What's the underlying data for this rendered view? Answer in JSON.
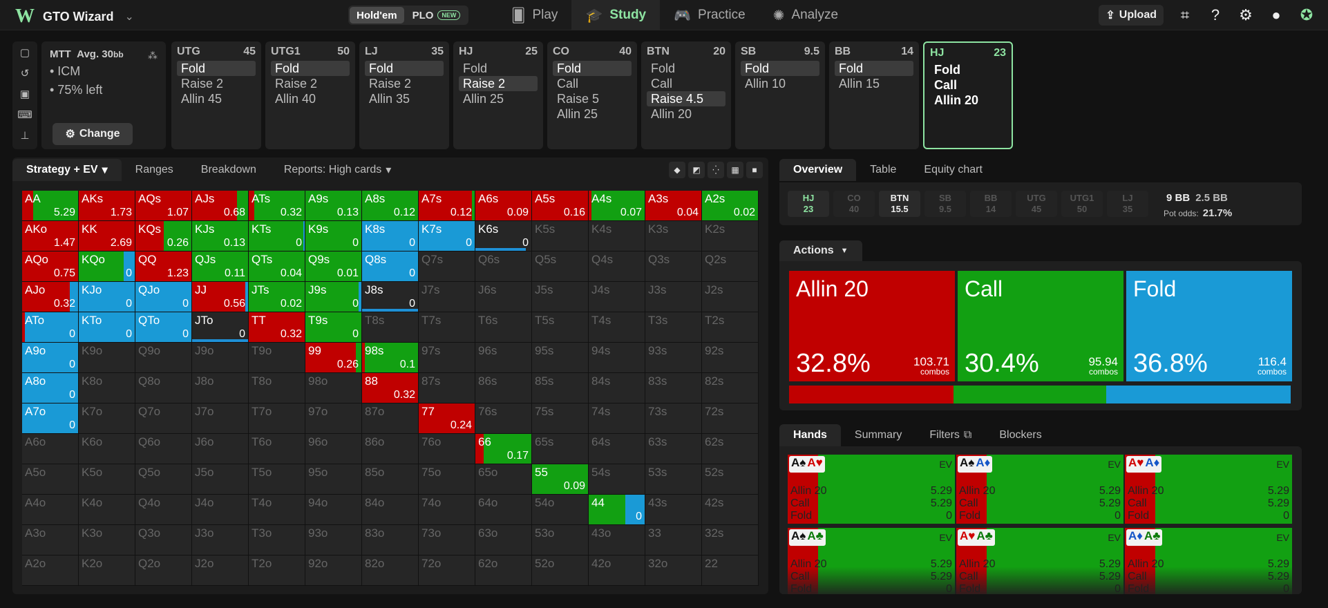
{
  "brand": {
    "logo": "W",
    "name": "GTO Wizard"
  },
  "game_toggle": {
    "holdem": "Hold'em",
    "plo": "PLO",
    "plo_badge": "NEW"
  },
  "nav": [
    {
      "label": "Play",
      "icon": "cards-icon",
      "active": false
    },
    {
      "label": "Study",
      "icon": "graduation-cap-icon",
      "active": true
    },
    {
      "label": "Practice",
      "icon": "gamepad-icon",
      "active": false
    },
    {
      "label": "Analyze",
      "icon": "lightbulb-icon",
      "active": false
    }
  ],
  "topright": {
    "upload": "Upload"
  },
  "mtt": {
    "title": "MTT",
    "depth": "Avg. 30",
    "depth_unit": "bb",
    "line1": "• ICM",
    "line2": "• 75% left",
    "change": "Change"
  },
  "positions": [
    {
      "name": "UTG",
      "stack": "45",
      "actions": [
        "Fold",
        "Raise 2",
        "Allin 45"
      ],
      "selected": 0
    },
    {
      "name": "UTG1",
      "stack": "50",
      "actions": [
        "Fold",
        "Raise 2",
        "Allin 40"
      ],
      "selected": 0
    },
    {
      "name": "LJ",
      "stack": "35",
      "actions": [
        "Fold",
        "Raise 2",
        "Allin 35"
      ],
      "selected": 0
    },
    {
      "name": "HJ",
      "stack": "25",
      "actions": [
        "Fold",
        "Raise 2",
        "Allin 25"
      ],
      "selected": 1
    },
    {
      "name": "CO",
      "stack": "40",
      "actions": [
        "Fold",
        "Call",
        "Raise 5",
        "Allin 25"
      ],
      "selected": 0
    },
    {
      "name": "BTN",
      "stack": "20",
      "actions": [
        "Fold",
        "Call",
        "Raise 4.5",
        "Allin 20"
      ],
      "selected": 2
    },
    {
      "name": "SB",
      "stack": "9.5",
      "actions": [
        "Fold",
        "Allin 10"
      ],
      "selected": 0
    },
    {
      "name": "BB",
      "stack": "14",
      "actions": [
        "Fold",
        "Allin 15"
      ],
      "selected": 0
    },
    {
      "name": "HJ",
      "stack": "23",
      "actions": [
        "Fold",
        "Call",
        "Allin 20"
      ],
      "selected": -1,
      "active": true
    }
  ],
  "left_tabs": [
    {
      "label": "Strategy + EV",
      "dropdown": true,
      "active": true
    },
    {
      "label": "Ranges"
    },
    {
      "label": "Breakdown"
    },
    {
      "label": "Reports: High cards",
      "dropdown": true
    }
  ],
  "colors": {
    "allin": "#c00000",
    "call": "#12a012",
    "fold": "#1a9ad6",
    "accent": "#8ee4a2"
  },
  "grid": [
    [
      [
        "AA",
        "5.29",
        0.2,
        0.8
      ],
      [
        "AKs",
        "1.73",
        1,
        0
      ],
      [
        "AQs",
        "1.07",
        1,
        0
      ],
      [
        "AJs",
        "0.68",
        0.8,
        0.2
      ],
      [
        "ATs",
        "0.32",
        0.1,
        0.9
      ],
      [
        "A9s",
        "0.13",
        0,
        1
      ],
      [
        "A8s",
        "0.12",
        0,
        1
      ],
      [
        "A7s",
        "0.12",
        0.95,
        0.05
      ],
      [
        "A6s",
        "0.09",
        1,
        0
      ],
      [
        "A5s",
        "0.16",
        1,
        0
      ],
      [
        "A4s",
        "0.07",
        0.05,
        0.95
      ],
      [
        "A3s",
        "0.04",
        1,
        0
      ],
      [
        "A2s",
        "0.02",
        0,
        1
      ]
    ],
    [
      [
        "AKo",
        "1.47",
        1,
        0
      ],
      [
        "KK",
        "2.69",
        1,
        0
      ],
      [
        "KQs",
        "0.26",
        0.5,
        0.5
      ],
      [
        "KJs",
        "0.13",
        0,
        1
      ],
      [
        "KTs",
        "0",
        0,
        0.97
      ],
      [
        "K9s",
        "0",
        0,
        1
      ],
      [
        "K8s",
        "0",
        0,
        0
      ],
      [
        "K7s",
        "0",
        0,
        0
      ],
      [
        "K6s",
        "0",
        0,
        0,
        0.9
      ],
      [
        "K5s",
        null
      ],
      [
        "K4s",
        null
      ],
      [
        "K3s",
        null
      ],
      [
        "K2s",
        null
      ]
    ],
    [
      [
        "AQo",
        "0.75",
        1,
        0
      ],
      [
        "KQo",
        "0",
        0,
        0.8
      ],
      [
        "QQ",
        "1.23",
        1,
        0
      ],
      [
        "QJs",
        "0.11",
        0,
        1
      ],
      [
        "QTs",
        "0.04",
        0,
        1
      ],
      [
        "Q9s",
        "0.01",
        0,
        1
      ],
      [
        "Q8s",
        "0",
        0,
        0
      ],
      [
        "Q7s",
        null
      ],
      [
        "Q6s",
        null
      ],
      [
        "Q5s",
        null
      ],
      [
        "Q4s",
        null
      ],
      [
        "Q3s",
        null
      ],
      [
        "Q2s",
        null
      ]
    ],
    [
      [
        "AJo",
        "0.32",
        0.85,
        0
      ],
      [
        "KJo",
        "0",
        0,
        0
      ],
      [
        "QJo",
        "0",
        0,
        0
      ],
      [
        "JJ",
        "0.56",
        0.95,
        0
      ],
      [
        "JTs",
        "0.02",
        0,
        1
      ],
      [
        "J9s",
        "0",
        0,
        0.95
      ],
      [
        "J8s",
        "0",
        0,
        0,
        1
      ],
      [
        "J7s",
        null
      ],
      [
        "J6s",
        null
      ],
      [
        "J5s",
        null
      ],
      [
        "J4s",
        null
      ],
      [
        "J3s",
        null
      ],
      [
        "J2s",
        null
      ]
    ],
    [
      [
        "ATo",
        "0",
        0.05,
        0
      ],
      [
        "KTo",
        "0",
        0,
        0
      ],
      [
        "QTo",
        "0",
        0,
        0
      ],
      [
        "JTo",
        "0",
        0,
        0,
        1
      ],
      [
        "TT",
        "0.32",
        1,
        0
      ],
      [
        "T9s",
        "0",
        0,
        1
      ],
      [
        "T8s",
        null
      ],
      [
        "T7s",
        null
      ],
      [
        "T6s",
        null
      ],
      [
        "T5s",
        null
      ],
      [
        "T4s",
        null
      ],
      [
        "T3s",
        null
      ],
      [
        "T2s",
        null
      ]
    ],
    [
      [
        "A9o",
        "0",
        0,
        0
      ],
      [
        "K9o",
        null
      ],
      [
        "Q9o",
        null
      ],
      [
        "J9o",
        null
      ],
      [
        "T9o",
        null
      ],
      [
        "99",
        "0.26",
        0.9,
        0.1
      ],
      [
        "98s",
        "0.1",
        0.05,
        0.95
      ],
      [
        "97s",
        null
      ],
      [
        "96s",
        null
      ],
      [
        "95s",
        null
      ],
      [
        "94s",
        null
      ],
      [
        "93s",
        null
      ],
      [
        "92s",
        null
      ]
    ],
    [
      [
        "A8o",
        "0",
        0,
        0
      ],
      [
        "K8o",
        null
      ],
      [
        "Q8o",
        null
      ],
      [
        "J8o",
        null
      ],
      [
        "T8o",
        null
      ],
      [
        "98o",
        null
      ],
      [
        "88",
        "0.32",
        1,
        0
      ],
      [
        "87s",
        null
      ],
      [
        "86s",
        null
      ],
      [
        "85s",
        null
      ],
      [
        "84s",
        null
      ],
      [
        "83s",
        null
      ],
      [
        "82s",
        null
      ]
    ],
    [
      [
        "A7o",
        "0",
        0,
        0
      ],
      [
        "K7o",
        null
      ],
      [
        "Q7o",
        null
      ],
      [
        "J7o",
        null
      ],
      [
        "T7o",
        null
      ],
      [
        "97o",
        null
      ],
      [
        "87o",
        null
      ],
      [
        "77",
        "0.24",
        1,
        0
      ],
      [
        "76s",
        null
      ],
      [
        "75s",
        null
      ],
      [
        "74s",
        null
      ],
      [
        "73s",
        null
      ],
      [
        "72s",
        null
      ]
    ],
    [
      [
        "A6o",
        null
      ],
      [
        "K6o",
        null
      ],
      [
        "Q6o",
        null
      ],
      [
        "J6o",
        null
      ],
      [
        "T6o",
        null
      ],
      [
        "96o",
        null
      ],
      [
        "86o",
        null
      ],
      [
        "76o",
        null
      ],
      [
        "66",
        "0.17",
        0.15,
        0.85
      ],
      [
        "65s",
        null
      ],
      [
        "64s",
        null
      ],
      [
        "63s",
        null
      ],
      [
        "62s",
        null
      ]
    ],
    [
      [
        "A5o",
        null
      ],
      [
        "K5o",
        null
      ],
      [
        "Q5o",
        null
      ],
      [
        "J5o",
        null
      ],
      [
        "T5o",
        null
      ],
      [
        "95o",
        null
      ],
      [
        "85o",
        null
      ],
      [
        "75o",
        null
      ],
      [
        "65o",
        null
      ],
      [
        "55",
        "0.09",
        0,
        1
      ],
      [
        "54s",
        null
      ],
      [
        "53s",
        null
      ],
      [
        "52s",
        null
      ]
    ],
    [
      [
        "A4o",
        null
      ],
      [
        "K4o",
        null
      ],
      [
        "Q4o",
        null
      ],
      [
        "J4o",
        null
      ],
      [
        "T4o",
        null
      ],
      [
        "94o",
        null
      ],
      [
        "84o",
        null
      ],
      [
        "74o",
        null
      ],
      [
        "64o",
        null
      ],
      [
        "54o",
        null
      ],
      [
        "44",
        "0",
        0,
        0.65
      ],
      [
        "43s",
        null
      ],
      [
        "42s",
        null
      ]
    ],
    [
      [
        "A3o",
        null
      ],
      [
        "K3o",
        null
      ],
      [
        "Q3o",
        null
      ],
      [
        "J3o",
        null
      ],
      [
        "T3o",
        null
      ],
      [
        "93o",
        null
      ],
      [
        "83o",
        null
      ],
      [
        "73o",
        null
      ],
      [
        "63o",
        null
      ],
      [
        "53o",
        null
      ],
      [
        "43o",
        null
      ],
      [
        "33",
        null
      ],
      [
        "32s",
        null
      ]
    ],
    [
      [
        "A2o",
        null
      ],
      [
        "K2o",
        null
      ],
      [
        "Q2o",
        null
      ],
      [
        "J2o",
        null
      ],
      [
        "T2o",
        null
      ],
      [
        "92o",
        null
      ],
      [
        "82o",
        null
      ],
      [
        "72o",
        null
      ],
      [
        "62o",
        null
      ],
      [
        "52o",
        null
      ],
      [
        "42o",
        null
      ],
      [
        "32o",
        null
      ],
      [
        "22",
        null
      ]
    ]
  ],
  "right_tabs": [
    {
      "label": "Overview",
      "active": true
    },
    {
      "label": "Table"
    },
    {
      "label": "Equity chart"
    }
  ],
  "seat_summary": [
    {
      "name": "HJ",
      "stack": "23",
      "style": "hj"
    },
    {
      "name": "CO",
      "stack": "40"
    },
    {
      "name": "BTN",
      "stack": "15.5",
      "style": "btn"
    },
    {
      "name": "SB",
      "stack": "9.5"
    },
    {
      "name": "BB",
      "stack": "14"
    },
    {
      "name": "UTG",
      "stack": "45"
    },
    {
      "name": "UTG1",
      "stack": "50"
    },
    {
      "name": "LJ",
      "stack": "35"
    }
  ],
  "pot": {
    "main": "9 BB",
    "side": "2.5 BB",
    "odds_label": "Pot odds:",
    "odds_value": "21.7%"
  },
  "actions_header": "Actions",
  "actions": [
    {
      "name": "Allin 20",
      "pct": "32.8%",
      "combos": "103.71",
      "combos_label": "combos",
      "frac": 0.328,
      "color": "#c00000"
    },
    {
      "name": "Call",
      "pct": "30.4%",
      "combos": "95.94",
      "combos_label": "combos",
      "frac": 0.304,
      "color": "#12a012"
    },
    {
      "name": "Fold",
      "pct": "36.8%",
      "combos": "116.4",
      "combos_label": "combos",
      "frac": 0.368,
      "color": "#1a9ad6"
    }
  ],
  "hands_tabs": [
    {
      "label": "Hands",
      "active": true
    },
    {
      "label": "Summary"
    },
    {
      "label": "Filters",
      "icon": "copy-icon"
    },
    {
      "label": "Blockers"
    }
  ],
  "hand_cards": [
    {
      "cards": [
        [
          "A",
          "♠",
          "blk"
        ],
        [
          "A",
          "♥",
          "red"
        ]
      ]
    },
    {
      "cards": [
        [
          "A",
          "♠",
          "blk"
        ],
        [
          "A",
          "♦",
          "blu"
        ]
      ]
    },
    {
      "cards": [
        [
          "A",
          "♥",
          "red"
        ],
        [
          "A",
          "♦",
          "blu"
        ]
      ]
    },
    {
      "cards": [
        [
          "A",
          "♠",
          "blk"
        ],
        [
          "A",
          "♣",
          "grn"
        ]
      ]
    },
    {
      "cards": [
        [
          "A",
          "♥",
          "red"
        ],
        [
          "A",
          "♣",
          "grn"
        ]
      ]
    },
    {
      "cards": [
        [
          "A",
          "♦",
          "blu"
        ],
        [
          "A",
          "♣",
          "grn"
        ]
      ]
    }
  ],
  "hand_rows": [
    [
      "Allin 20",
      "5.29"
    ],
    [
      "Call",
      "5.29"
    ],
    [
      "Fold",
      "0"
    ]
  ],
  "hand_ev_label": "EV"
}
